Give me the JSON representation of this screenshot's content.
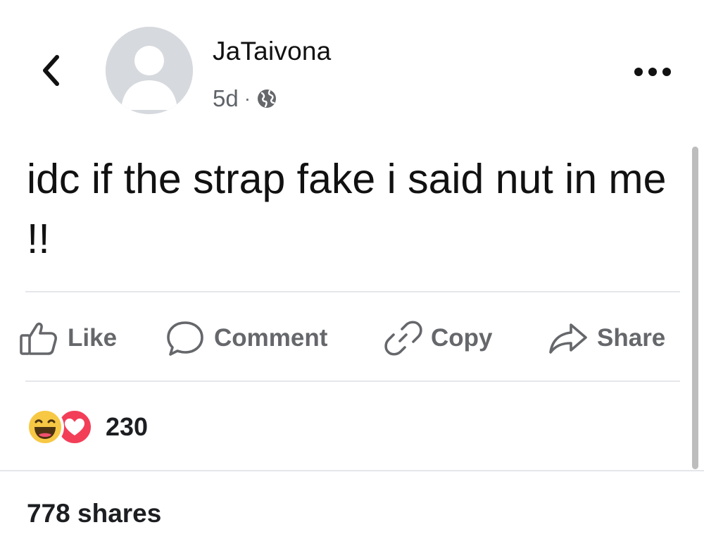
{
  "header": {
    "author_name": "JaTaivona",
    "time_ago": "5d",
    "separator": "·",
    "audience_icon": "globe-icon",
    "back_icon": "chevron-left-icon",
    "more_icon": "more-horizontal-icon",
    "avatar_icon": "default-avatar-icon"
  },
  "post": {
    "text": "idc if the strap fake i said nut in me !!"
  },
  "actions": [
    {
      "label": "Like",
      "icon": "thumbs-up-icon"
    },
    {
      "label": "Comment",
      "icon": "comment-bubble-icon"
    },
    {
      "label": "Copy",
      "icon": "link-icon"
    },
    {
      "label": "Share",
      "icon": "share-arrow-icon"
    }
  ],
  "reactions": {
    "icons": [
      "haha-reaction-icon",
      "love-reaction-icon"
    ],
    "count": "230"
  },
  "footer": {
    "shares": "778 shares"
  },
  "colors": {
    "text_primary": "#1c1e21",
    "text_secondary": "#65676b",
    "divider": "#e4e6eb",
    "love_red": "#f33e58",
    "haha_yellow": "#f7c844"
  }
}
